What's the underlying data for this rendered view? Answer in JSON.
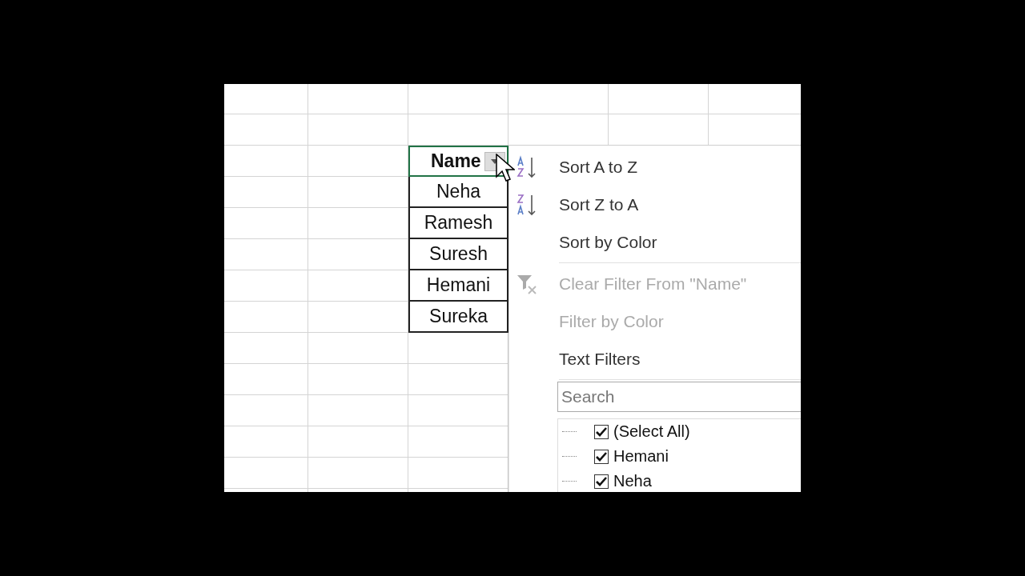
{
  "sheet": {
    "table": {
      "header": "Name",
      "rows": [
        "Neha",
        "Ramesh",
        "Suresh",
        "Hemani",
        "Sureka"
      ]
    }
  },
  "filter_menu": {
    "items": [
      {
        "kind": "sort_asc",
        "label": "Sort A to Z",
        "disabled": false
      },
      {
        "kind": "sort_desc",
        "label": "Sort Z to A",
        "disabled": false
      },
      {
        "kind": "plain",
        "label": "Sort by Color",
        "disabled": false
      },
      {
        "kind": "separator"
      },
      {
        "kind": "clear_filter",
        "label": "Clear Filter From \"Name\"",
        "disabled": true
      },
      {
        "kind": "plain",
        "label": "Filter by Color",
        "disabled": true
      },
      {
        "kind": "plain",
        "label": "Text Filters",
        "disabled": false
      },
      {
        "kind": "separator"
      }
    ],
    "search": {
      "placeholder": "Search"
    },
    "values": [
      {
        "label": "(Select All)",
        "checked": true
      },
      {
        "label": "Hemani",
        "checked": true
      },
      {
        "label": "Neha",
        "checked": true
      }
    ]
  }
}
